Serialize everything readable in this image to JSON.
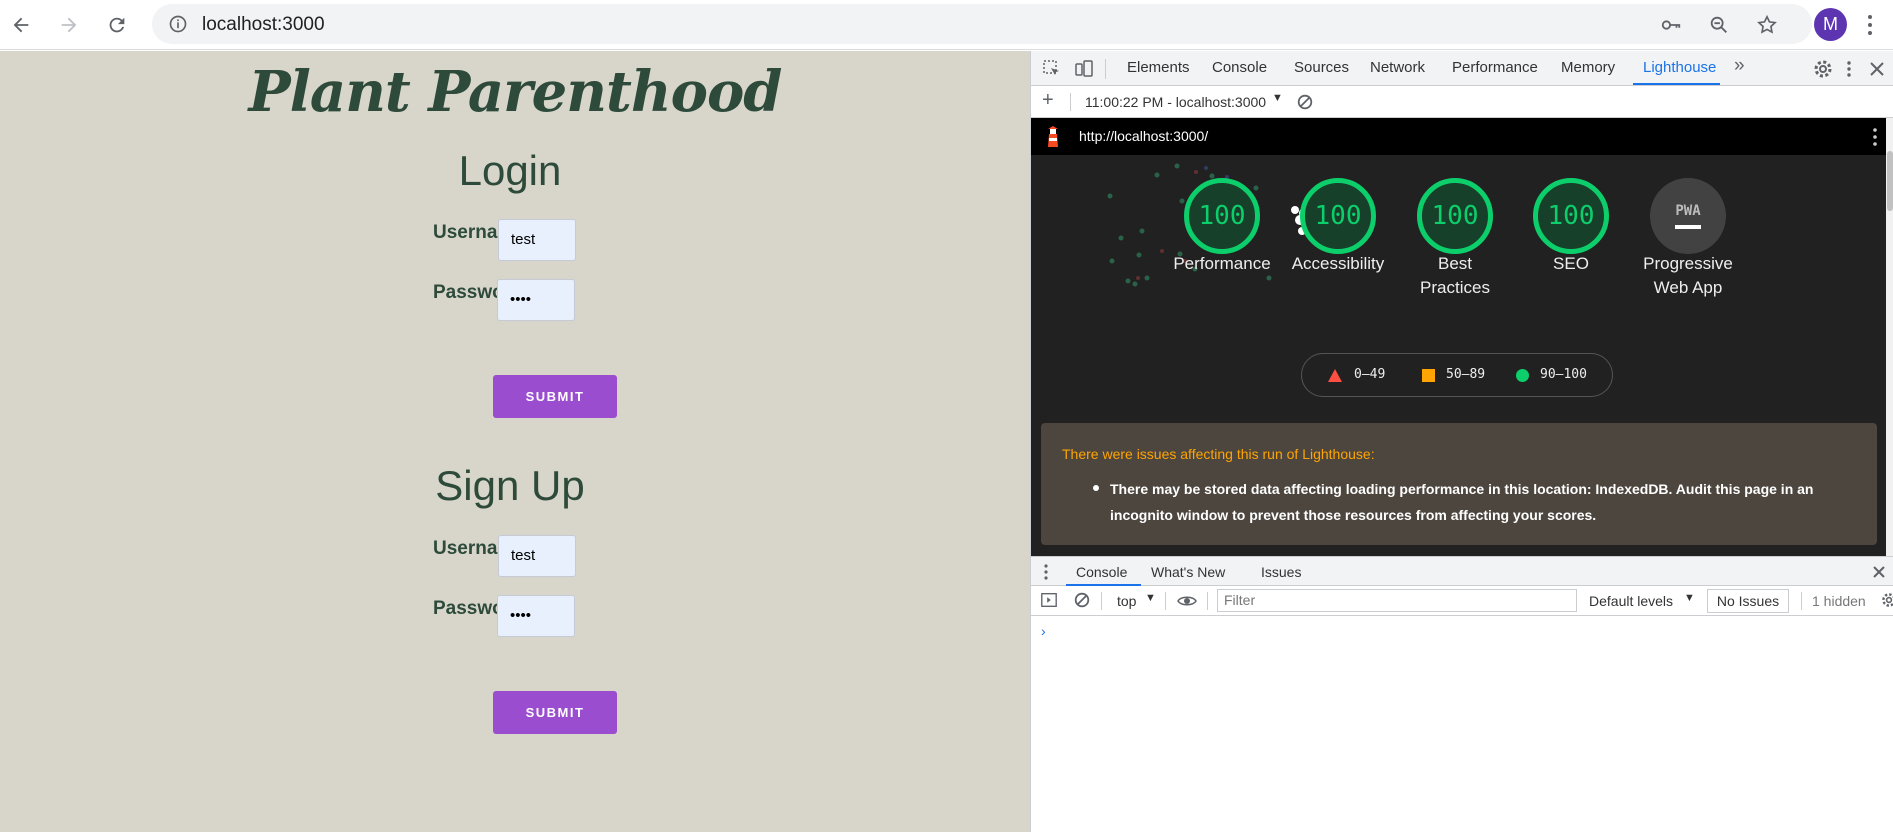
{
  "browser": {
    "url": "localhost:3000",
    "profile_initial": "M"
  },
  "page": {
    "site_title": "Plant Parenthood",
    "login": {
      "heading": "Login",
      "username_label": "Username",
      "username_value": "test",
      "password_label": "Password",
      "password_value": "••••",
      "submit_label": "SUBMIT"
    },
    "signup": {
      "heading": "Sign Up",
      "username_label": "Username",
      "username_value": "test",
      "password_label": "Password",
      "password_value": "••••",
      "submit_label": "SUBMIT"
    }
  },
  "devtools": {
    "tabs": [
      "Elements",
      "Console",
      "Sources",
      "Network",
      "Performance",
      "Memory",
      "Lighthouse"
    ],
    "active_tab": "Lighthouse",
    "more_tabs": "»",
    "lighthouse": {
      "run_label": "11:00:22 PM - localhost:3000",
      "report_url": "http://localhost:3000/",
      "gauges": [
        {
          "score": "100",
          "label": "Performance"
        },
        {
          "score": "100",
          "label": "Accessibility"
        },
        {
          "score": "100",
          "label": "Best Practices"
        },
        {
          "score": "100",
          "label": "SEO"
        }
      ],
      "pwa": {
        "badge": "PWA",
        "label": "Progressive Web App"
      },
      "legend": [
        {
          "range": "0–49",
          "color": "#ff4e42",
          "shape": "triangle"
        },
        {
          "range": "50–89",
          "color": "#ffa400",
          "shape": "square"
        },
        {
          "range": "90–100",
          "color": "#0cce6b",
          "shape": "circle"
        }
      ],
      "warning_title": "There were issues affecting this run of Lighthouse:",
      "warning_text": "There may be stored data affecting loading performance in this location: IndexedDB. Audit this page in an incognito window to prevent those resources from affecting your scores."
    },
    "drawer": {
      "tabs": [
        "Console",
        "What's New",
        "Issues"
      ],
      "context": "top",
      "filter_placeholder": "Filter",
      "levels": "Default levels",
      "issues": "No Issues",
      "hidden": "1 hidden",
      "prompt": "›"
    }
  },
  "colors": {
    "page_bg": "#d8d6ca",
    "title_green": "#2d4a3a",
    "submit_purple": "#9b4dcf",
    "score_green": "#0cce6b"
  }
}
